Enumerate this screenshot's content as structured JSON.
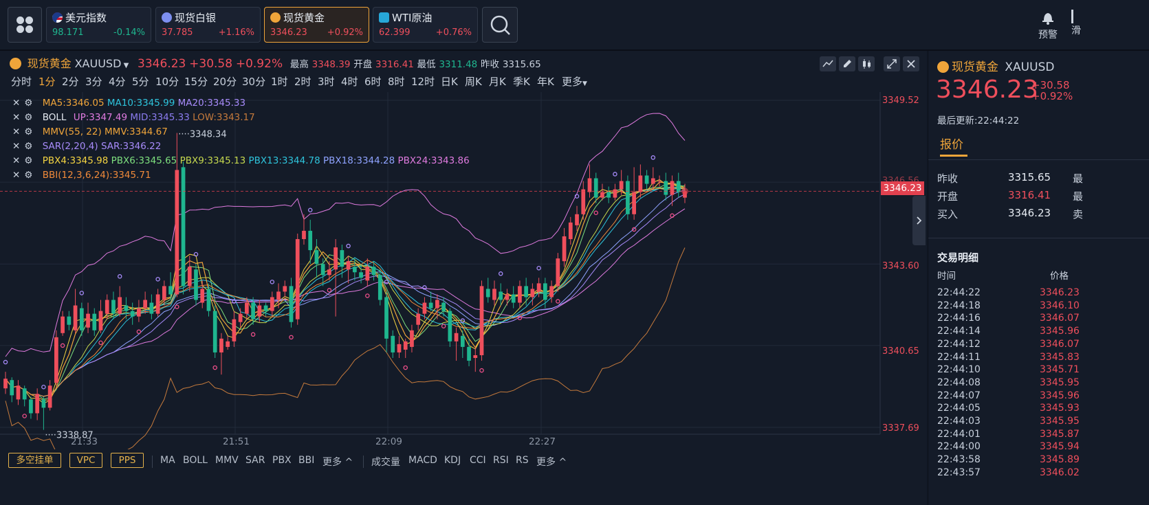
{
  "topbar": {
    "tickers": [
      {
        "name": "美元指数",
        "price": "98.171",
        "change": "-0.14%",
        "dir": "dn",
        "icon": "us-flag-icon"
      },
      {
        "name": "现货白银",
        "price": "37.785",
        "change": "+1.16%",
        "dir": "up",
        "icon": "silver-icon"
      },
      {
        "name": "现货黄金",
        "price": "3346.23",
        "change": "+0.92%",
        "dir": "up",
        "icon": "gold-icon"
      },
      {
        "name": "WTI原油",
        "price": "62.399",
        "change": "+0.76%",
        "dir": "up",
        "icon": "oil-icon"
      }
    ],
    "alert_label": "预警",
    "right_edge_label": "滑"
  },
  "chart_header": {
    "name": "现货黄金",
    "symbol": "XAUUSD",
    "price": "3346.23",
    "change": "+30.58",
    "change_pct": "+0.92%",
    "high_label": "最高",
    "high": "3348.39",
    "open_label": "开盘",
    "open": "3316.41",
    "low_label": "最低",
    "low": "3311.48",
    "prev_label": "昨收",
    "prev": "3315.65"
  },
  "intervals": [
    "分时",
    "1分",
    "2分",
    "3分",
    "4分",
    "5分",
    "10分",
    "15分",
    "20分",
    "30分",
    "1时",
    "2时",
    "3时",
    "4时",
    "6时",
    "8时",
    "12时",
    "日K",
    "周K",
    "月K",
    "季K",
    "年K",
    "更多"
  ],
  "active_interval": "1分",
  "indicators": {
    "ma": {
      "ma5": "MA5:3346.05",
      "ma10": "MA10:3345.99",
      "ma20": "MA20:3345.33"
    },
    "boll": {
      "name": "BOLL",
      "up": "UP:3347.49",
      "mid": "MID:3345.33",
      "low": "LOW:3343.17"
    },
    "mmv": {
      "name": "MMV(55, 22)",
      "val": "MMV:3344.67"
    },
    "sar": {
      "name": "SAR(2,20,4)",
      "val": "SAR:3346.22"
    },
    "pbx": {
      "p4": "PBX4:3345.98",
      "p6": "PBX6:3345.65",
      "p9": "PBX9:3345.13",
      "p13": "PBX13:3344.78",
      "p18": "PBX18:3344.28",
      "p24": "PBX24:3343.86"
    },
    "bbi": "BBI(12,3,6,24):3345.71"
  },
  "chart_data": {
    "type": "candlestick",
    "symbol": "XAUUSD",
    "interval": "1分",
    "price_axis_ticks": [
      "3349.52",
      "3346.56",
      "3343.60",
      "3340.65",
      "3337.69"
    ],
    "time_axis_ticks": [
      "21:33",
      "21:51",
      "22:09",
      "22:27"
    ],
    "ylim": [
      3337.69,
      3349.52
    ],
    "annotations": {
      "high_mark": "3348.34",
      "low_mark": "3338.87"
    },
    "current_price": "3346.23",
    "candles": [
      {
        "o": 3339.1,
        "c": 3339.45,
        "h": 3339.7,
        "l": 3338.9
      },
      {
        "o": 3339.4,
        "c": 3338.85,
        "h": 3339.5,
        "l": 3338.6
      },
      {
        "o": 3338.7,
        "c": 3339.2,
        "h": 3339.4,
        "l": 3338.5
      },
      {
        "o": 3339.1,
        "c": 3338.7,
        "h": 3339.2,
        "l": 3338.45
      },
      {
        "o": 3338.7,
        "c": 3338.2,
        "h": 3338.8,
        "l": 3338.0
      },
      {
        "o": 3338.2,
        "c": 3338.9,
        "h": 3339.1,
        "l": 3337.95
      },
      {
        "o": 3338.7,
        "c": 3338.4,
        "h": 3338.8,
        "l": 3337.6
      },
      {
        "o": 3338.4,
        "c": 3339.2,
        "h": 3339.4,
        "l": 3338.3
      },
      {
        "o": 3339.3,
        "c": 3340.95,
        "h": 3341.2,
        "l": 3339.2
      },
      {
        "o": 3341.1,
        "c": 3341.7,
        "h": 3341.9,
        "l": 3341.0
      },
      {
        "o": 3341.7,
        "c": 3341.4,
        "h": 3341.9,
        "l": 3341.2
      },
      {
        "o": 3341.2,
        "c": 3342.1,
        "h": 3342.7,
        "l": 3341.1
      },
      {
        "o": 3342.0,
        "c": 3341.2,
        "h": 3342.2,
        "l": 3341.0
      },
      {
        "o": 3341.3,
        "c": 3341.8,
        "h": 3342.2,
        "l": 3341.1
      },
      {
        "o": 3341.8,
        "c": 3341.2,
        "h": 3342.0,
        "l": 3341.0
      },
      {
        "o": 3341.2,
        "c": 3341.9,
        "h": 3342.3,
        "l": 3341.1
      },
      {
        "o": 3341.8,
        "c": 3342.3,
        "h": 3342.5,
        "l": 3341.6
      },
      {
        "o": 3342.3,
        "c": 3341.8,
        "h": 3342.6,
        "l": 3341.6
      },
      {
        "o": 3341.8,
        "c": 3342.4,
        "h": 3342.8,
        "l": 3341.7
      },
      {
        "o": 3342.1,
        "c": 3341.9,
        "h": 3342.4,
        "l": 3341.6
      },
      {
        "o": 3341.9,
        "c": 3341.7,
        "h": 3342.2,
        "l": 3341.4
      },
      {
        "o": 3341.7,
        "c": 3342.0,
        "h": 3342.3,
        "l": 3341.5
      },
      {
        "o": 3342.0,
        "c": 3342.3,
        "h": 3342.6,
        "l": 3341.8
      },
      {
        "o": 3342.2,
        "c": 3341.8,
        "h": 3342.5,
        "l": 3341.6
      },
      {
        "o": 3341.8,
        "c": 3342.5,
        "h": 3342.7,
        "l": 3341.7
      },
      {
        "o": 3342.3,
        "c": 3342.8,
        "h": 3343.0,
        "l": 3342.1
      },
      {
        "o": 3342.8,
        "c": 3342.5,
        "h": 3343.3,
        "l": 3342.3
      },
      {
        "o": 3342.5,
        "c": 3347.0,
        "h": 3348.34,
        "l": 3342.4
      },
      {
        "o": 3347.1,
        "c": 3342.8,
        "h": 3347.3,
        "l": 3342.5
      },
      {
        "o": 3342.8,
        "c": 3343.5,
        "h": 3343.9,
        "l": 3342.6
      },
      {
        "o": 3343.4,
        "c": 3342.3,
        "h": 3343.6,
        "l": 3342.1
      },
      {
        "o": 3342.2,
        "c": 3342.7,
        "h": 3343.0,
        "l": 3342.0
      },
      {
        "o": 3342.7,
        "c": 3341.9,
        "h": 3342.9,
        "l": 3341.7
      },
      {
        "o": 3341.9,
        "c": 3340.4,
        "h": 3342.1,
        "l": 3340.2
      },
      {
        "o": 3340.4,
        "c": 3340.9,
        "h": 3341.1,
        "l": 3339.6
      },
      {
        "o": 3340.6,
        "c": 3340.8,
        "h": 3341.0,
        "l": 3340.5
      },
      {
        "o": 3340.8,
        "c": 3341.6,
        "h": 3341.9,
        "l": 3340.6
      },
      {
        "o": 3341.5,
        "c": 3341.8,
        "h": 3342.0,
        "l": 3341.3
      },
      {
        "o": 3341.8,
        "c": 3342.2,
        "h": 3342.4,
        "l": 3341.6
      },
      {
        "o": 3342.2,
        "c": 3341.6,
        "h": 3342.4,
        "l": 3341.4
      },
      {
        "o": 3341.7,
        "c": 3342.1,
        "h": 3342.3,
        "l": 3341.5
      },
      {
        "o": 3342.1,
        "c": 3341.9,
        "h": 3342.2,
        "l": 3341.7
      },
      {
        "o": 3341.9,
        "c": 3342.4,
        "h": 3342.6,
        "l": 3341.7
      },
      {
        "o": 3342.3,
        "c": 3342.6,
        "h": 3342.9,
        "l": 3342.0
      },
      {
        "o": 3342.6,
        "c": 3342.8,
        "h": 3343.0,
        "l": 3342.4
      },
      {
        "o": 3342.8,
        "c": 3341.5,
        "h": 3343.1,
        "l": 3341.3
      },
      {
        "o": 3341.6,
        "c": 3344.5,
        "h": 3344.7,
        "l": 3341.4
      },
      {
        "o": 3344.5,
        "c": 3344.8,
        "h": 3345.4,
        "l": 3344.3
      },
      {
        "o": 3344.8,
        "c": 3344.1,
        "h": 3345.2,
        "l": 3343.6
      },
      {
        "o": 3344.1,
        "c": 3343.6,
        "h": 3344.5,
        "l": 3343.1
      },
      {
        "o": 3343.6,
        "c": 3343.2,
        "h": 3343.8,
        "l": 3342.8
      },
      {
        "o": 3343.2,
        "c": 3343.4,
        "h": 3343.7,
        "l": 3343.0
      },
      {
        "o": 3343.4,
        "c": 3344.2,
        "h": 3344.5,
        "l": 3341.7
      },
      {
        "o": 3344.1,
        "c": 3343.5,
        "h": 3344.3,
        "l": 3343.1
      },
      {
        "o": 3343.4,
        "c": 3343.7,
        "h": 3343.9,
        "l": 3342.9
      },
      {
        "o": 3343.5,
        "c": 3343.3,
        "h": 3343.8,
        "l": 3343.0
      },
      {
        "o": 3343.3,
        "c": 3343.1,
        "h": 3343.6,
        "l": 3342.9
      },
      {
        "o": 3343.0,
        "c": 3343.5,
        "h": 3343.8,
        "l": 3342.8
      },
      {
        "o": 3343.5,
        "c": 3343.2,
        "h": 3343.7,
        "l": 3343.0
      },
      {
        "o": 3343.2,
        "c": 3342.3,
        "h": 3343.4,
        "l": 3342.1
      },
      {
        "o": 3342.4,
        "c": 3340.9,
        "h": 3342.6,
        "l": 3340.4
      },
      {
        "o": 3341.0,
        "c": 3340.4,
        "h": 3341.2,
        "l": 3340.2
      },
      {
        "o": 3340.4,
        "c": 3340.7,
        "h": 3341.0,
        "l": 3340.2
      },
      {
        "o": 3340.5,
        "c": 3340.8,
        "h": 3340.9,
        "l": 3340.2
      },
      {
        "o": 3340.6,
        "c": 3341.2,
        "h": 3341.4,
        "l": 3340.4
      },
      {
        "o": 3341.4,
        "c": 3341.8,
        "h": 3342.0,
        "l": 3341.2
      },
      {
        "o": 3341.8,
        "c": 3342.2,
        "h": 3342.4,
        "l": 3341.6
      },
      {
        "o": 3342.2,
        "c": 3342.0,
        "h": 3342.6,
        "l": 3341.9
      },
      {
        "o": 3342.0,
        "c": 3342.3,
        "h": 3342.5,
        "l": 3341.6
      },
      {
        "o": 3342.2,
        "c": 3341.9,
        "h": 3342.4,
        "l": 3341.7
      },
      {
        "o": 3341.9,
        "c": 3340.8,
        "h": 3342.0,
        "l": 3340.6
      },
      {
        "o": 3340.8,
        "c": 3341.1,
        "h": 3341.3,
        "l": 3340.1
      },
      {
        "o": 3341.0,
        "c": 3340.6,
        "h": 3341.2,
        "l": 3340.2
      },
      {
        "o": 3340.6,
        "c": 3340.1,
        "h": 3340.9,
        "l": 3339.9
      },
      {
        "o": 3340.2,
        "c": 3340.3,
        "h": 3340.6,
        "l": 3339.7
      },
      {
        "o": 3340.3,
        "c": 3342.8,
        "h": 3343.0,
        "l": 3340.1
      },
      {
        "o": 3342.7,
        "c": 3342.4,
        "h": 3343.1,
        "l": 3342.2
      },
      {
        "o": 3342.3,
        "c": 3342.7,
        "h": 3343.0,
        "l": 3342.1
      },
      {
        "o": 3342.6,
        "c": 3342.3,
        "h": 3342.9,
        "l": 3342.1
      },
      {
        "o": 3342.3,
        "c": 3342.5,
        "h": 3342.7,
        "l": 3342.1
      },
      {
        "o": 3342.5,
        "c": 3342.2,
        "h": 3342.8,
        "l": 3342.0
      },
      {
        "o": 3342.2,
        "c": 3342.8,
        "h": 3343.0,
        "l": 3342.0
      },
      {
        "o": 3342.8,
        "c": 3342.4,
        "h": 3343.1,
        "l": 3342.1
      },
      {
        "o": 3342.4,
        "c": 3342.7,
        "h": 3342.9,
        "l": 3342.1
      },
      {
        "o": 3342.6,
        "c": 3342.9,
        "h": 3343.1,
        "l": 3342.4
      },
      {
        "o": 3342.9,
        "c": 3342.3,
        "h": 3343.1,
        "l": 3342.0
      },
      {
        "o": 3342.4,
        "c": 3342.8,
        "h": 3343.0,
        "l": 3342.2
      },
      {
        "o": 3342.8,
        "c": 3343.8,
        "h": 3344.0,
        "l": 3342.6
      },
      {
        "o": 3343.7,
        "c": 3344.6,
        "h": 3344.9,
        "l": 3343.5
      },
      {
        "o": 3344.5,
        "c": 3345.1,
        "h": 3345.3,
        "l": 3344.3
      },
      {
        "o": 3345.0,
        "c": 3345.4,
        "h": 3345.7,
        "l": 3344.8
      },
      {
        "o": 3345.4,
        "c": 3346.3,
        "h": 3346.6,
        "l": 3345.2
      },
      {
        "o": 3346.2,
        "c": 3346.7,
        "h": 3347.2,
        "l": 3346.0
      },
      {
        "o": 3346.7,
        "c": 3346.0,
        "h": 3346.9,
        "l": 3345.8
      },
      {
        "o": 3346.0,
        "c": 3346.2,
        "h": 3346.5,
        "l": 3345.9
      },
      {
        "o": 3346.2,
        "c": 3346.0,
        "h": 3346.4,
        "l": 3345.8
      },
      {
        "o": 3346.0,
        "c": 3346.3,
        "h": 3346.5,
        "l": 3345.9
      },
      {
        "o": 3346.3,
        "c": 3346.6,
        "h": 3347.0,
        "l": 3346.1
      },
      {
        "o": 3346.6,
        "c": 3345.4,
        "h": 3346.8,
        "l": 3345.2
      },
      {
        "o": 3345.4,
        "c": 3346.2,
        "h": 3347.1,
        "l": 3345.2
      },
      {
        "o": 3346.2,
        "c": 3346.8,
        "h": 3347.2,
        "l": 3346.0
      },
      {
        "o": 3346.8,
        "c": 3346.5,
        "h": 3347.0,
        "l": 3346.3
      },
      {
        "o": 3346.5,
        "c": 3346.7,
        "h": 3347.1,
        "l": 3346.3
      },
      {
        "o": 3346.6,
        "c": 3346.6,
        "h": 3346.8,
        "l": 3346.4
      },
      {
        "o": 3346.6,
        "c": 3346.1,
        "h": 3346.9,
        "l": 3345.9
      },
      {
        "o": 3346.1,
        "c": 3346.6,
        "h": 3346.8,
        "l": 3345.7
      },
      {
        "o": 3346.6,
        "c": 3346.2,
        "h": 3346.9,
        "l": 3346.0
      },
      {
        "o": 3346.0,
        "c": 3346.23,
        "h": 3346.5,
        "l": 3345.8
      }
    ]
  },
  "bottom": {
    "tags": [
      "多空挂单",
      "VPC",
      "PPS"
    ],
    "main_indicators": [
      "MA",
      "BOLL",
      "MMV",
      "SAR",
      "PBX",
      "BBI",
      "更多 ^"
    ],
    "sub_indicators": [
      "成交量",
      "MACD",
      "KDJ",
      "CCI",
      "RSI",
      "RS",
      "更多 ^"
    ]
  },
  "side": {
    "name": "现货黄金",
    "symbol": "XAUUSD",
    "price": "3346.23",
    "change": "+30.58",
    "change_pct": "+0.92%",
    "updated": "最后更新:22:44:22",
    "tab": "报价",
    "rows": [
      {
        "label": "昨收",
        "value": "3315.65",
        "cls": "n"
      },
      {
        "label": "开盘",
        "value": "3316.41",
        "cls": "up"
      },
      {
        "label": "买入",
        "value": "3346.23",
        "cls": "n"
      }
    ],
    "edge_labels": [
      "最",
      "最",
      "卖"
    ],
    "trades_title": "交易明细",
    "col_time": "时间",
    "col_price": "价格",
    "trades": [
      {
        "t": "22:44:22",
        "p": "3346.23"
      },
      {
        "t": "22:44:18",
        "p": "3346.10"
      },
      {
        "t": "22:44:16",
        "p": "3346.07"
      },
      {
        "t": "22:44:14",
        "p": "3345.96"
      },
      {
        "t": "22:44:12",
        "p": "3346.07"
      },
      {
        "t": "22:44:11",
        "p": "3345.83"
      },
      {
        "t": "22:44:10",
        "p": "3345.71"
      },
      {
        "t": "22:44:08",
        "p": "3345.95"
      },
      {
        "t": "22:44:07",
        "p": "3345.96"
      },
      {
        "t": "22:44:05",
        "p": "3345.93"
      },
      {
        "t": "22:44:03",
        "p": "3345.95"
      },
      {
        "t": "22:44:01",
        "p": "3345.87"
      },
      {
        "t": "22:44:00",
        "p": "3345.94"
      },
      {
        "t": "22:43:58",
        "p": "3345.89"
      },
      {
        "t": "22:43:57",
        "p": "3346.02"
      }
    ]
  },
  "colors": {
    "up": "#ef4f5c",
    "down": "#1fb68f",
    "accent": "#f0a53a"
  }
}
